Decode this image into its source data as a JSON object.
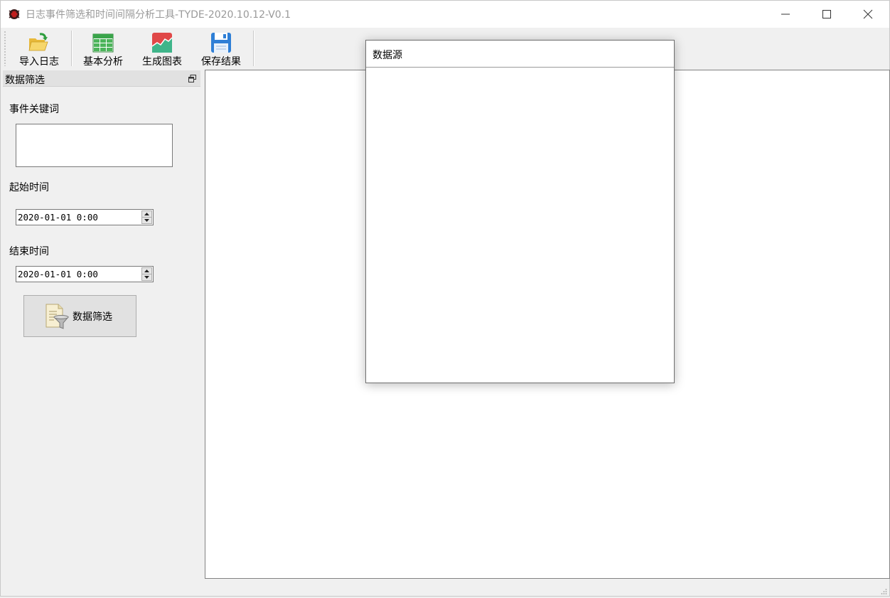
{
  "window": {
    "title": "日志事件筛选和时间间隔分析工具-TYDE-2020.10.12-V0.1"
  },
  "toolbar": {
    "items": [
      {
        "label": "导入日志",
        "icon": "folder-open-icon"
      },
      {
        "label": "基本分析",
        "icon": "table-grid-icon"
      },
      {
        "label": "生成图表",
        "icon": "chart-icon"
      },
      {
        "label": "保存结果",
        "icon": "save-disk-icon"
      }
    ]
  },
  "filter_panel": {
    "title": "数据筛选",
    "keyword_label": "事件关键词",
    "keyword_value": "",
    "start_label": "起始时间",
    "start_value": "2020-01-01  0:00",
    "end_label": "结束时间",
    "end_value": "2020-01-01  0:00",
    "filter_button_label": "数据筛选"
  },
  "data_source": {
    "title": "数据源"
  },
  "colors": {
    "accent_green": "#2e9e3e",
    "chart_red": "#e04848",
    "disk_blue": "#2f7fd6"
  }
}
